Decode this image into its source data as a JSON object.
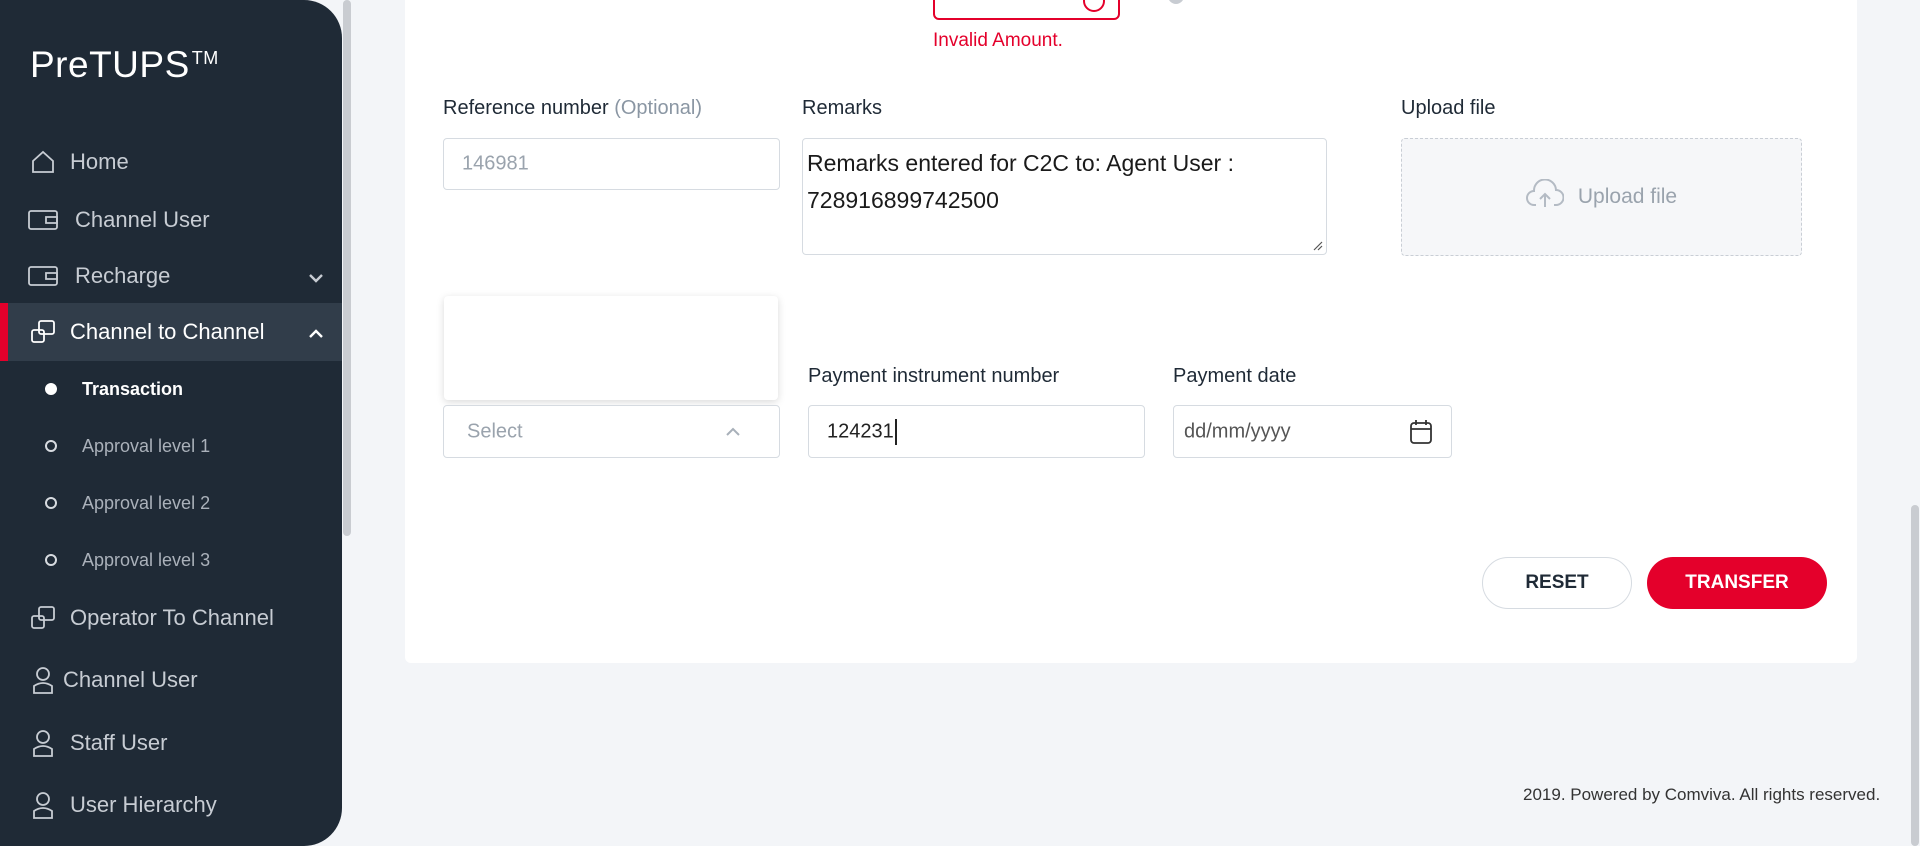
{
  "brand": {
    "name": "PreTUPS",
    "mark": "TM"
  },
  "sidebar": {
    "items": [
      {
        "label": "Home",
        "icon": "home-icon"
      },
      {
        "label": "Channel User",
        "icon": "wallet-icon"
      },
      {
        "label": "Recharge",
        "icon": "wallet-icon",
        "chevron": "down"
      },
      {
        "label": "Channel to Channel",
        "icon": "transfer-icon",
        "chevron": "up",
        "active": true
      },
      {
        "label": "Operator To Channel",
        "icon": "transfer-icon"
      },
      {
        "label": "Channel User",
        "icon": "user-icon"
      },
      {
        "label": "Staff User",
        "icon": "user-icon"
      },
      {
        "label": "User Hierarchy",
        "icon": "user-icon"
      }
    ],
    "subitems": [
      {
        "label": "Transaction",
        "active": true
      },
      {
        "label": "Approval level 1"
      },
      {
        "label": "Approval level 2"
      },
      {
        "label": "Approval level 3"
      }
    ]
  },
  "form": {
    "error_text": "Invalid Amount.",
    "reference": {
      "label": "Reference number",
      "optional": "(Optional)",
      "value": "146981"
    },
    "remarks": {
      "label": "Remarks",
      "value": "Remarks entered for C2C to: Agent User : 728916899742500"
    },
    "upload": {
      "label": "Upload file",
      "button": "Upload file"
    },
    "payment_type": {
      "placeholder": "Select"
    },
    "payment_instrument": {
      "label": "Payment instrument number",
      "value": "124231"
    },
    "payment_date": {
      "label": "Payment date",
      "placeholder": "dd/mm/yyyy"
    },
    "reset_label": "RESET",
    "transfer_label": "TRANSFER"
  },
  "footer": {
    "text": "2019. Powered by Comviva. All rights reserved."
  },
  "colors": {
    "accent": "#e4002b",
    "sidebar_bg": "#1f2a36"
  }
}
